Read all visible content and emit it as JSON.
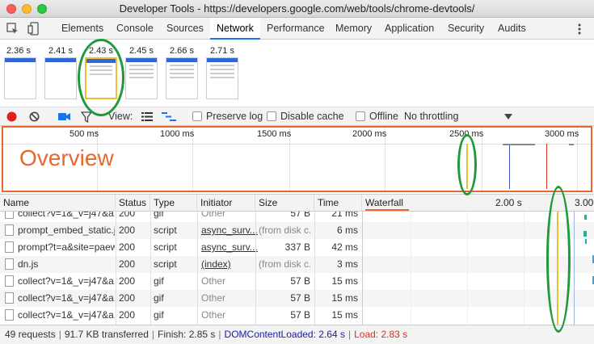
{
  "window": {
    "title": "Developer Tools - https://developers.google.com/web/tools/chrome-devtools/"
  },
  "tabs": [
    "Elements",
    "Console",
    "Sources",
    "Network",
    "Performance",
    "Memory",
    "Application",
    "Security",
    "Audits"
  ],
  "active_tab": "Network",
  "filmstrip": {
    "times": [
      "2.36 s",
      "2.41 s",
      "2.43 s",
      "2.45 s",
      "2.66 s",
      "2.71 s"
    ]
  },
  "toolbar": {
    "view_label": "View:",
    "preserve_log": "Preserve log",
    "disable_cache": "Disable cache",
    "offline": "Offline",
    "throttling": "No throttling"
  },
  "overview": {
    "ticks": [
      "500 ms",
      "1000 ms",
      "1500 ms",
      "2000 ms",
      "2500 ms",
      "3000 ms"
    ],
    "label": "Overview"
  },
  "table": {
    "headers": {
      "name": "Name",
      "status": "Status",
      "type": "Type",
      "initiator": "Initiator",
      "size": "Size",
      "time": "Time",
      "waterfall": "Waterfall"
    },
    "waterfall_ticks": [
      "2.00 s",
      "3.00"
    ],
    "rows": [
      {
        "name": "collect?v=1&_v=j47&a...",
        "status": "200",
        "type": "gif",
        "initiator": "Other",
        "size": "57 B",
        "time": "21 ms"
      },
      {
        "name": "prompt_embed_static.js",
        "status": "200",
        "type": "script",
        "initiator": "async_surv...",
        "size": "(from disk c...",
        "time": "6 ms"
      },
      {
        "name": "prompt?t=a&site=paew...",
        "status": "200",
        "type": "script",
        "initiator": "async_surv...",
        "size": "337 B",
        "time": "42 ms"
      },
      {
        "name": "dn.js",
        "status": "200",
        "type": "script",
        "initiator": "(index)",
        "size": "(from disk c...",
        "time": "3 ms"
      },
      {
        "name": "collect?v=1&_v=j47&a...",
        "status": "200",
        "type": "gif",
        "initiator": "Other",
        "size": "57 B",
        "time": "15 ms"
      },
      {
        "name": "collect?v=1&_v=j47&a...",
        "status": "200",
        "type": "gif",
        "initiator": "Other",
        "size": "57 B",
        "time": "15 ms"
      },
      {
        "name": "collect?v=1&_v=j47&a...",
        "status": "200",
        "type": "gif",
        "initiator": "Other",
        "size": "57 B",
        "time": "15 ms"
      }
    ]
  },
  "status_bar": {
    "requests": "49 requests",
    "transferred": "91.7 KB transferred",
    "finish": "Finish: 2.85 s",
    "dom": "DOMContentLoaded: 2.64 s",
    "load": "Load: 2.83 s"
  },
  "colors": {
    "accent": "#1a73e8",
    "annotation_orange": "#e8672f",
    "annotation_green": "#1f9a3a",
    "dom_blue": "#1a1aa6",
    "load_red": "#d93025"
  }
}
